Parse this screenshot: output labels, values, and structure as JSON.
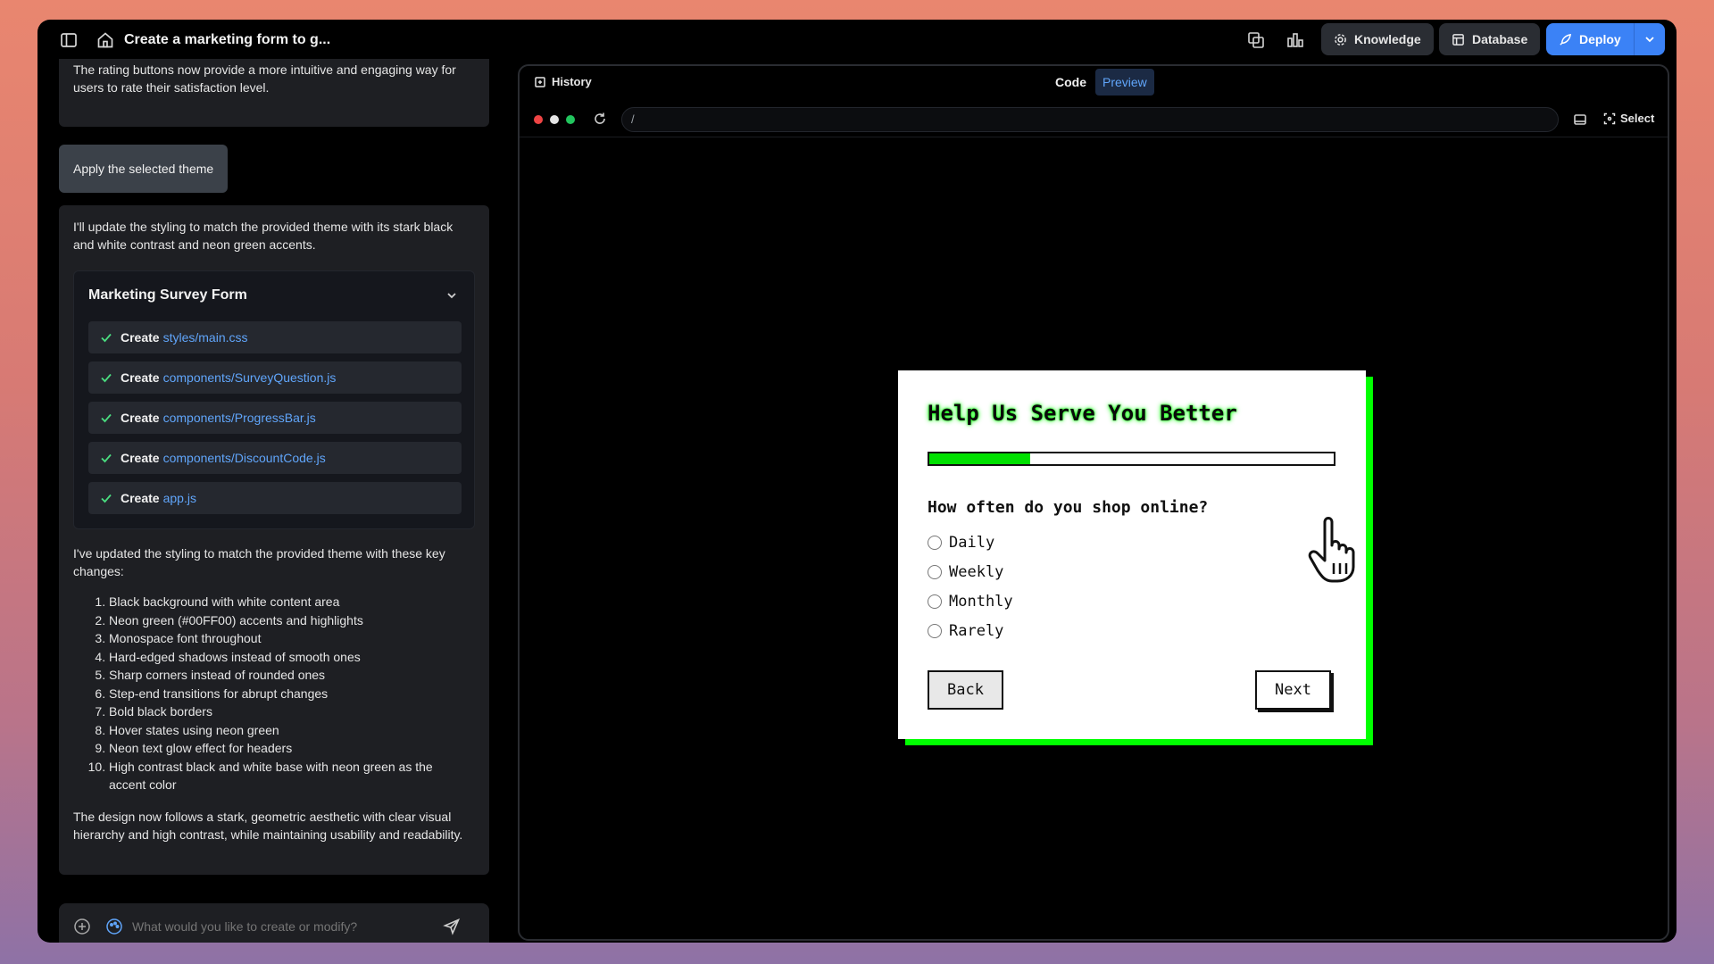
{
  "header": {
    "title": "Create a marketing form to g...",
    "buttons": {
      "knowledge": "Knowledge",
      "database": "Database",
      "deploy": "Deploy"
    }
  },
  "chat": {
    "prev_message": "The rating buttons now provide a more intuitive and engaging way for users to rate their satisfaction level.",
    "user_message": "Apply the selected theme",
    "assistant_intro": "I'll update the styling to match the provided theme with its stark black and white contrast and neon green accents.",
    "plan": {
      "title": "Marketing Survey Form",
      "steps": [
        {
          "verb": "Create",
          "path": "styles/main.css"
        },
        {
          "verb": "Create",
          "path": "components/SurveyQuestion.js"
        },
        {
          "verb": "Create",
          "path": "components/ProgressBar.js"
        },
        {
          "verb": "Create",
          "path": "components/DiscountCode.js"
        },
        {
          "verb": "Create",
          "path": "app.js"
        }
      ]
    },
    "summary_intro": "I've updated the styling to match the provided theme with these key changes:",
    "changes": [
      "Black background with white content area",
      "Neon green (#00FF00) accents and highlights",
      "Monospace font throughout",
      "Hard-edged shadows instead of smooth ones",
      "Sharp corners instead of rounded ones",
      "Step-end transitions for abrupt changes",
      "Bold black borders",
      "Hover states using neon green",
      "Neon text glow effect for headers",
      "High contrast black and white base with neon green as the accent color"
    ],
    "closing": "The design now follows a stark, geometric aesthetic with clear visual hierarchy and high contrast, while maintaining usability and readability.",
    "input_placeholder": "What would you like to create or modify?"
  },
  "preview": {
    "history_label": "History",
    "tab_code": "Code",
    "tab_preview": "Preview",
    "url": "/",
    "select_label": "Select",
    "form": {
      "heading": "Help Us Serve You Better",
      "progress": 0.25,
      "question": "How often do you shop online?",
      "options": [
        "Daily",
        "Weekly",
        "Monthly",
        "Rarely"
      ],
      "back_label": "Back",
      "next_label": "Next"
    }
  },
  "colors": {
    "accent_blue": "#3b82f6",
    "neon_green": "#00ff00"
  }
}
